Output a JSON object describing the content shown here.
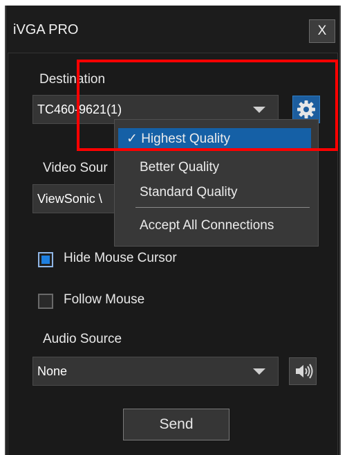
{
  "window": {
    "title": "iVGA PRO",
    "close_label": "X"
  },
  "destination": {
    "label": "Destination",
    "value": "TC460-9621(1)"
  },
  "video_source": {
    "label": "Video Sour",
    "value": "ViewSonic \\"
  },
  "quality_menu": {
    "items": [
      {
        "label": "Highest Quality",
        "checked": true
      },
      {
        "label": "Better Quality",
        "checked": false
      },
      {
        "label": "Standard Quality",
        "checked": false
      },
      {
        "label": "Accept All Connections",
        "checked": false
      }
    ],
    "check_mark": "✓"
  },
  "options": {
    "hide_mouse_cursor": {
      "label": "Hide Mouse Cursor",
      "checked": true
    },
    "follow_mouse": {
      "label": "Follow Mouse",
      "checked": false
    }
  },
  "audio_source": {
    "label": "Audio Source",
    "value": "None"
  },
  "send_label": "Send",
  "icons": {
    "settings": "gear-icon",
    "audio": "speaker-icon",
    "dropdown": "chevron-down-icon"
  },
  "colors": {
    "window_bg": "#1a1a1a",
    "accent_blue": "#1560a6",
    "highlight_red": "#ff0000"
  }
}
